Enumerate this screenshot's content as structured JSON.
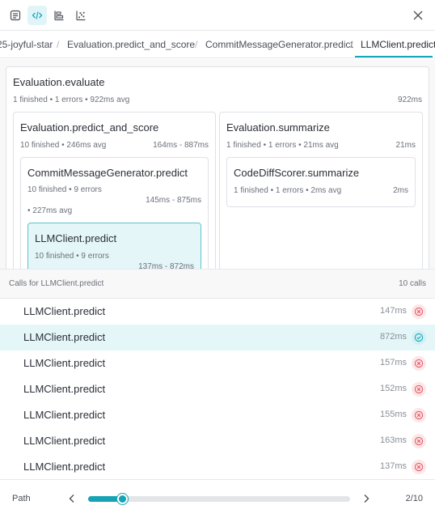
{
  "breadcrumb": {
    "items": [
      "25-joyful-star",
      "Evaluation.predict_and_score",
      "CommitMessageGenerator.predict",
      "LLMClient.predict"
    ],
    "separator": "/"
  },
  "tree": {
    "root": {
      "title": "Evaluation.evaluate",
      "meta": "1 finished • 1 errors • 922ms avg",
      "range": "922ms"
    },
    "predict_and_score": {
      "title": "Evaluation.predict_and_score",
      "meta": "10 finished • 246ms avg",
      "range": "164ms - 887ms"
    },
    "commit_generator": {
      "title": "CommitMessageGenerator.predict",
      "meta1": "10 finished • 9 errors",
      "meta2": "• 227ms avg",
      "range": "145ms - 875ms"
    },
    "llm_client": {
      "title": "LLMClient.predict",
      "meta": "10 finished • 9 errors",
      "range": "137ms - 872ms"
    },
    "summarize": {
      "title": "Evaluation.summarize",
      "meta": "1 finished • 1 errors • 21ms avg",
      "range": "21ms"
    },
    "scorer_summarize": {
      "title": "CodeDiffScorer.summarize",
      "meta": "1 finished • 1 errors • 2ms avg",
      "range": "2ms"
    }
  },
  "calls": {
    "header_label": "Calls for LLMClient.predict",
    "count_label": "10 calls",
    "rows": [
      {
        "name": "LLMClient.predict",
        "duration": "147ms",
        "status": "error"
      },
      {
        "name": "LLMClient.predict",
        "duration": "872ms",
        "status": "success"
      },
      {
        "name": "LLMClient.predict",
        "duration": "157ms",
        "status": "error"
      },
      {
        "name": "LLMClient.predict",
        "duration": "152ms",
        "status": "error"
      },
      {
        "name": "LLMClient.predict",
        "duration": "155ms",
        "status": "error"
      },
      {
        "name": "LLMClient.predict",
        "duration": "163ms",
        "status": "error"
      },
      {
        "name": "LLMClient.predict",
        "duration": "137ms",
        "status": "error"
      }
    ],
    "selected_index": 1
  },
  "footer": {
    "path_label": "Path",
    "page_label": "2/10",
    "slider_fraction": 0.13
  },
  "colors": {
    "accent": "#13a9ba",
    "selected_bg": "#e4f6f8",
    "error": "#e35d6a",
    "success": "#13a9ba"
  },
  "icons": {
    "toolbar": [
      "document-icon",
      "code-icon",
      "timeline-icon",
      "scatter-icon"
    ],
    "close": "close-icon"
  }
}
